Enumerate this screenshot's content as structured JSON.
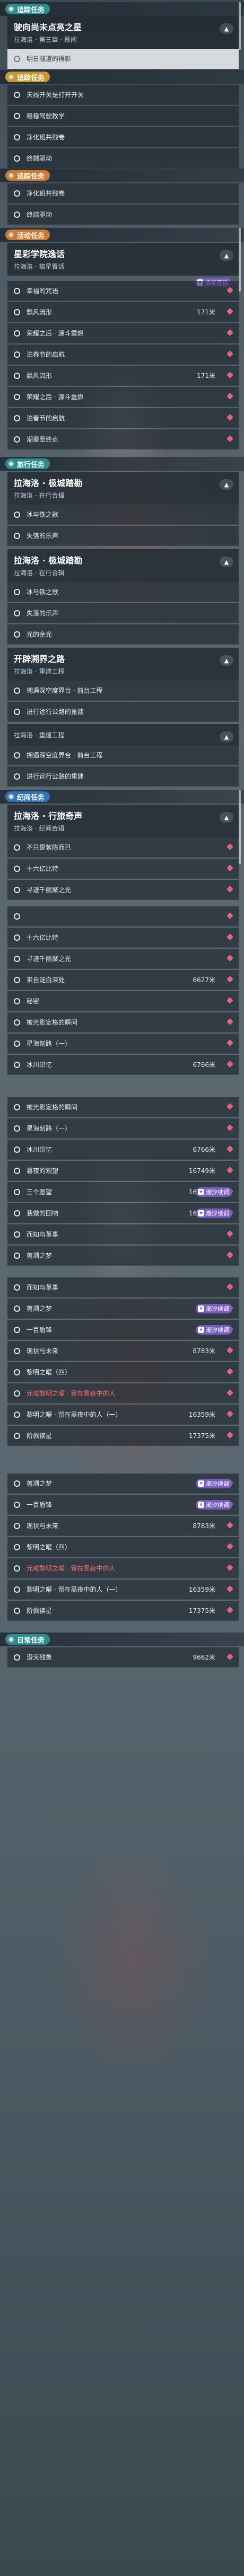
{
  "theme": {
    "teal": "#2a8f8c",
    "orange": "#d0782b",
    "blue": "#2d74b8",
    "green": "#3a9a6a",
    "badge": "#7d5fcd",
    "danger": "#ff6a6a"
  },
  "sections": {
    "tracking": "追踪任务",
    "side1": "追踪任务",
    "cut1": "追踪任务",
    "activity": "活动任务",
    "trip": "旅行任务",
    "world": "纪闻任务",
    "daily": "日常任务"
  },
  "quests": {
    "q1": {
      "title": "驶向尚未点亮之星",
      "sub": "拉海洛 · 第三章 · 幕间",
      "tasks": [
        "明日隧道的得影"
      ]
    },
    "side": {
      "tasks": [
        "天线开关是打开开关",
        "稳稳驾驶教学",
        "净化班共残卷",
        "终端驱动"
      ]
    },
    "side_cut": {
      "tasks": [
        "净化班共残卷",
        "终端驱动"
      ]
    },
    "q2": {
      "title": "星彩学院逸话",
      "sub": "拉海洛 · 搞星置话",
      "badge": "请星宽话",
      "tasks": [
        {
          "label": "幸福的咒语",
          "dist": ""
        },
        {
          "label": "飘风流形",
          "dist": "171米"
        },
        {
          "label": "荣耀之后 · 源斗重燃",
          "dist": ""
        },
        {
          "label": "泊春节的启航",
          "dist": ""
        },
        {
          "label": "飘风流形",
          "dist": "171米"
        },
        {
          "label": "荣耀之后 · 源斗重燃",
          "dist": ""
        },
        {
          "label": "泊春节的启航",
          "dist": ""
        },
        {
          "label": "潮豪至终点",
          "dist": ""
        }
      ]
    },
    "q3": {
      "title": "拉海洛 · 极城踏勘",
      "sub": "拉海洛 · 在行合辑",
      "tasks": [
        "冰与铁之歌",
        "失落的乐声"
      ]
    },
    "q4": {
      "title": "拉海洛 · 极城踏勘",
      "sub": "拉海洛 · 在行合辑",
      "tasks": [
        "冰与铁之歌",
        "失落的乐声",
        "光的余光"
      ]
    },
    "q5": {
      "title": "开辟溯界之路",
      "sub": "拉海洛 · 重建工程",
      "tasks": [
        "拥遇深空度界台 · 前台工程",
        "进行远行公路的重建"
      ]
    },
    "q5b": {
      "sub": "拉海洛 · 重建工程",
      "tasks": [
        "拥遇深空度界台 · 前台工程",
        "进行远行公路的重建"
      ]
    },
    "q6": {
      "title": "拉海洛 · 行旅奇声",
      "sub": "拉海洛 · 纪闻合辑",
      "tasks": [
        {
          "label": "不只是紫陈而已",
          "dist": ""
        },
        {
          "label": "十六亿比特",
          "dist": ""
        },
        {
          "label": "寻迹千丽聚之光",
          "dist": ""
        }
      ]
    },
    "list1": [
      {
        "label": "",
        "dist": ""
      },
      {
        "label": "十六亿比特",
        "dist": ""
      },
      {
        "label": "寻迹千丽聚之光",
        "dist": ""
      },
      {
        "label": "来自淀白深处",
        "dist": "6627米"
      },
      {
        "label": "秘密",
        "dist": ""
      },
      {
        "label": "被光影定格的瞬间",
        "dist": ""
      },
      {
        "label": "星海刻路（一）",
        "dist": ""
      },
      {
        "label": "冰川印忆",
        "dist": "6766米"
      }
    ],
    "list2": [
      {
        "label": "被光影定格的瞬间",
        "dist": ""
      },
      {
        "label": "星海刻路（一）",
        "dist": ""
      },
      {
        "label": "冰川印忆",
        "dist": "6766米"
      },
      {
        "label": "暮夜的观望",
        "dist": "16749米"
      },
      {
        "label": "三个愿望",
        "dist": "16725米",
        "badge": "潮汐续调"
      },
      {
        "label": "我做的回响",
        "dist": "16888米",
        "badge": "潮汐续调"
      },
      {
        "label": "而知与革事",
        "dist": ""
      },
      {
        "label": "剪溯之梦",
        "dist": ""
      }
    ],
    "list3": [
      {
        "label": "而知与革事",
        "dist": ""
      },
      {
        "label": "剪溯之梦",
        "dist": "",
        "badge": "潮汐续调"
      },
      {
        "label": "一百盾锋",
        "dist": "",
        "badge": "潮汐续调"
      },
      {
        "label": "现状与未来",
        "dist": "8783米"
      },
      {
        "label": "黎明之曜（四）",
        "dist": ""
      },
      {
        "label": "元戒黎明之曜 · 留在黑夜中的人",
        "dist": "",
        "red": true
      },
      {
        "label": "黎明之曜 · 留在黑夜中的人（一）",
        "dist": "16359米"
      },
      {
        "label": "阶佩读星",
        "dist": "17375米"
      }
    ],
    "list4": [
      {
        "label": "剪溯之梦",
        "dist": "",
        "badge": "潮汐续调"
      },
      {
        "label": "一百盾锋",
        "dist": "",
        "badge": "潮汐续调"
      },
      {
        "label": "现状与未来",
        "dist": "8783米"
      },
      {
        "label": "黎明之曜（四）",
        "dist": ""
      },
      {
        "label": "元戒黎明之曜 · 留在黑夜中的人",
        "dist": "",
        "red": true
      },
      {
        "label": "黎明之曜 · 留在黑夜中的人（一）",
        "dist": "16359米"
      },
      {
        "label": "阶佩读星",
        "dist": "17375米"
      }
    ],
    "daily": {
      "tasks": [
        {
          "label": "澄天残象",
          "dist": "9662米"
        }
      ]
    }
  }
}
